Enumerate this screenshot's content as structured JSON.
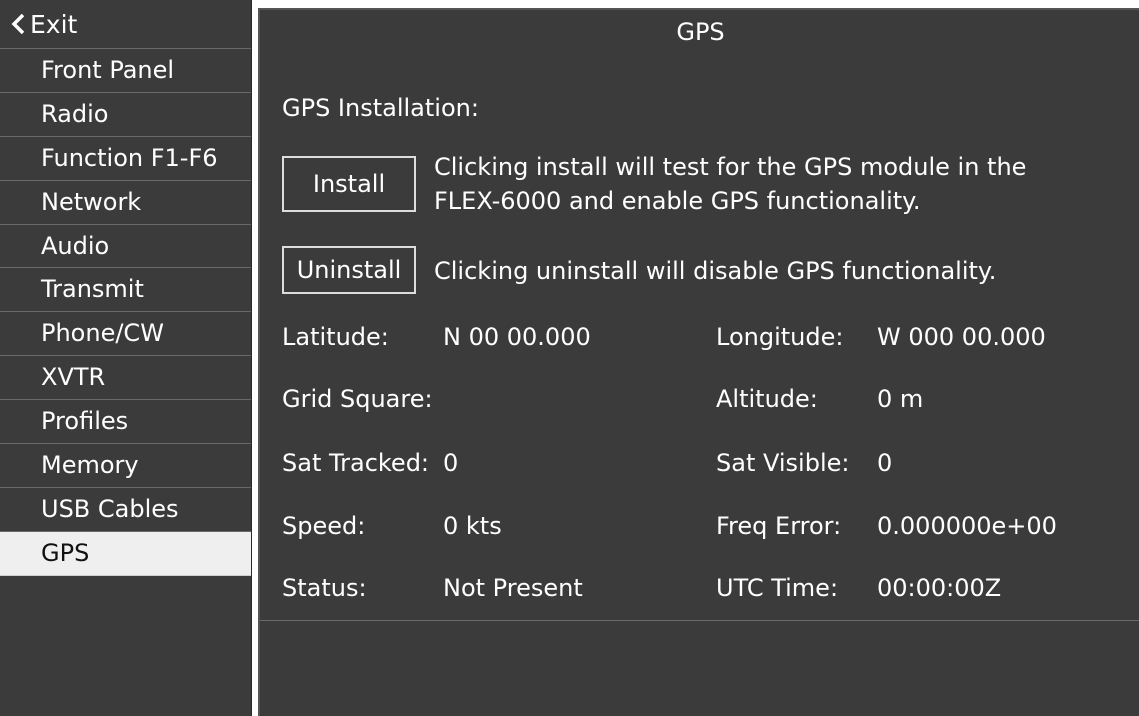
{
  "sidebar": {
    "exit_label": "Exit",
    "items": [
      {
        "label": "Front Panel"
      },
      {
        "label": "Radio"
      },
      {
        "label": "Function F1-F6"
      },
      {
        "label": "Network"
      },
      {
        "label": "Audio"
      },
      {
        "label": "Transmit"
      },
      {
        "label": "Phone/CW"
      },
      {
        "label": "XVTR"
      },
      {
        "label": "Profiles"
      },
      {
        "label": "Memory"
      },
      {
        "label": "USB Cables"
      },
      {
        "label": "GPS",
        "selected": true
      }
    ]
  },
  "panel": {
    "title": "GPS",
    "installation_label": "GPS Installation:",
    "install_button": "Install",
    "install_desc_line1": "Clicking install will test for the GPS module in the",
    "install_desc_line2": "FLEX-6000 and enable GPS functionality.",
    "uninstall_button": "Uninstall",
    "uninstall_desc": "Clicking uninstall will disable GPS functionality."
  },
  "fields": {
    "latitude": {
      "label": "Latitude:",
      "value": "N 00 00.000"
    },
    "longitude": {
      "label": "Longitude:",
      "value": "W 000 00.000"
    },
    "grid_square": {
      "label": "Grid Square:",
      "value": ""
    },
    "altitude": {
      "label": "Altitude:",
      "value": "0 m"
    },
    "sat_tracked": {
      "label": "Sat Tracked:",
      "value": "0"
    },
    "sat_visible": {
      "label": "Sat Visible:",
      "value": "0"
    },
    "speed": {
      "label": "Speed:",
      "value": "0 kts"
    },
    "freq_error": {
      "label": "Freq Error:",
      "value": "0.000000e+00"
    },
    "status": {
      "label": "Status:",
      "value": "Not Present"
    },
    "utc_time": {
      "label": "UTC Time:",
      "value": "00:00:00Z"
    }
  },
  "icons": {
    "exit": "chevron-left-icon"
  },
  "colors": {
    "background": "#3b3b3b",
    "selected_item_bg": "#efefef",
    "text": "#ffffff",
    "selected_text": "#111111",
    "divider": "#6a6a6a"
  }
}
